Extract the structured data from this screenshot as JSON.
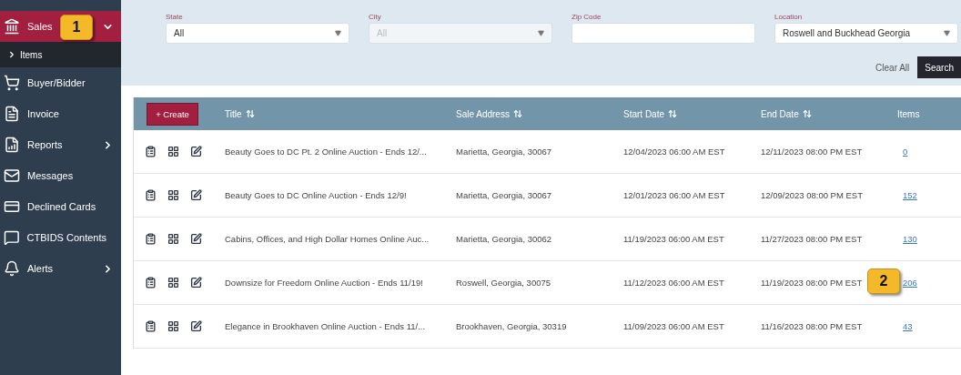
{
  "sidebar": {
    "items": [
      {
        "label": "Sales",
        "selected": true,
        "expanded": true,
        "callout": "1",
        "children": [
          {
            "label": "Items"
          }
        ]
      },
      {
        "label": "Buyer/Bidder",
        "selected": false
      },
      {
        "label": "Invoice",
        "selected": false
      },
      {
        "label": "Reports",
        "selected": false,
        "expanded": false
      },
      {
        "label": "Messages",
        "selected": false
      },
      {
        "label": "Declined Cards",
        "selected": false
      },
      {
        "label": "CTBIDS Contents",
        "selected": false
      },
      {
        "label": "Alerts",
        "selected": false,
        "expanded": false
      }
    ]
  },
  "filters": [
    {
      "label": "State",
      "kind": "select",
      "value": "All",
      "disabled": false
    },
    {
      "label": "City",
      "kind": "select",
      "value": "All",
      "disabled": true
    },
    {
      "label": "Zip Code",
      "kind": "text",
      "disabled": false
    },
    {
      "label": "Location",
      "kind": "select",
      "value": "Roswell and Buckhead Georgia",
      "disabled": false
    }
  ],
  "actions": {
    "clear": "Clear All",
    "search": "Search"
  },
  "table": {
    "create": "+ Create",
    "columns": [
      {
        "label": "Title",
        "sortable": true
      },
      {
        "label": "Sale Address",
        "sortable": true
      },
      {
        "label": "Start Date",
        "sortable": true
      },
      {
        "label": "End Date",
        "sortable": true
      },
      {
        "label": "Items",
        "sortable": false
      }
    ],
    "rows": [
      {
        "title": "Beauty Goes to DC Pt. 2 Online Auction - Ends 12/...",
        "address": "Marietta, Georgia, 30067",
        "start": "12/04/2023 06:00 AM EST",
        "end": "12/11/2023 08:00 PM EST",
        "items": "0"
      },
      {
        "title": "Beauty Goes to DC Online Auction - Ends 12/9!",
        "address": "Marietta, Georgia, 30067",
        "start": "12/01/2023 06:00 AM EST",
        "end": "12/09/2023 08:00 PM EST",
        "items": "152"
      },
      {
        "title": "Cabins, Offices, and High Dollar Homes Online Auc...",
        "address": "Marietta, Georgia, 30062",
        "start": "11/19/2023 06:00 AM EST",
        "end": "11/27/2023 08:00 PM EST",
        "items": "130"
      },
      {
        "title": "Downsize for Freedom Online Auction - Ends 11/19!",
        "address": "Roswell, Georgia, 30075",
        "start": "11/12/2023 06:00 AM EST",
        "end": "11/19/2023 08:00 PM EST",
        "items": "206",
        "callout": "2"
      },
      {
        "title": "Elegance in Brookhaven Online Auction - Ends 11/...",
        "address": "Brookhaven, Georgia, 30319",
        "start": "11/09/2023 06:00 AM EST",
        "end": "11/16/2023 08:00 PM EST",
        "items": "43"
      }
    ]
  }
}
